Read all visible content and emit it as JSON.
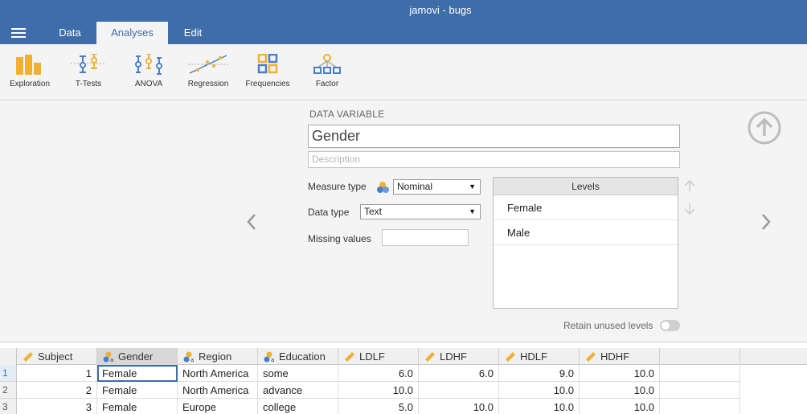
{
  "app": {
    "title": "jamovi - bugs"
  },
  "tabs": [
    {
      "label": "Data"
    },
    {
      "label": "Analyses",
      "active": true
    },
    {
      "label": "Edit"
    }
  ],
  "ribbon": [
    {
      "label": "Exploration",
      "icon": "exploration-icon"
    },
    {
      "label": "T-Tests",
      "icon": "t-tests-icon"
    },
    {
      "label": "ANOVA",
      "icon": "anova-icon"
    },
    {
      "label": "Regression",
      "icon": "regression-icon"
    },
    {
      "label": "Frequencies",
      "icon": "frequencies-icon"
    },
    {
      "label": "Factor",
      "icon": "factor-icon"
    }
  ],
  "editor": {
    "heading": "DATA VARIABLE",
    "name": "Gender",
    "description_placeholder": "Description",
    "measure_type_label": "Measure type",
    "measure_type_value": "Nominal",
    "data_type_label": "Data type",
    "data_type_value": "Text",
    "missing_values_label": "Missing values",
    "missing_values_value": "",
    "levels_header": "Levels",
    "levels": [
      "Female",
      "Male"
    ],
    "retain_unused_label": "Retain unused levels",
    "retain_unused": false
  },
  "sheet": {
    "columns": [
      {
        "name": "Subject",
        "type": "continuous"
      },
      {
        "name": "Gender",
        "type": "nominal",
        "active": true
      },
      {
        "name": "Region",
        "type": "nominal"
      },
      {
        "name": "Education",
        "type": "nominal"
      },
      {
        "name": "LDLF",
        "type": "continuous"
      },
      {
        "name": "LDHF",
        "type": "continuous"
      },
      {
        "name": "HDLF",
        "type": "continuous"
      },
      {
        "name": "HDHF",
        "type": "continuous"
      }
    ],
    "rows": [
      {
        "n": "1",
        "cells": [
          "1",
          "Female",
          "North America",
          "some",
          "6.0",
          "6.0",
          "9.0",
          "10.0"
        ]
      },
      {
        "n": "2",
        "cells": [
          "2",
          "Female",
          "North America",
          "advance",
          "10.0",
          "",
          "10.0",
          "10.0"
        ]
      },
      {
        "n": "3",
        "cells": [
          "3",
          "Female",
          "Europe",
          "college",
          "5.0",
          "10.0",
          "10.0",
          "10.0"
        ]
      }
    ]
  },
  "colors": {
    "accent": "#3e6da9",
    "ribbon_orange": "#f0b030",
    "ribbon_blue": "#4a7fc8"
  }
}
